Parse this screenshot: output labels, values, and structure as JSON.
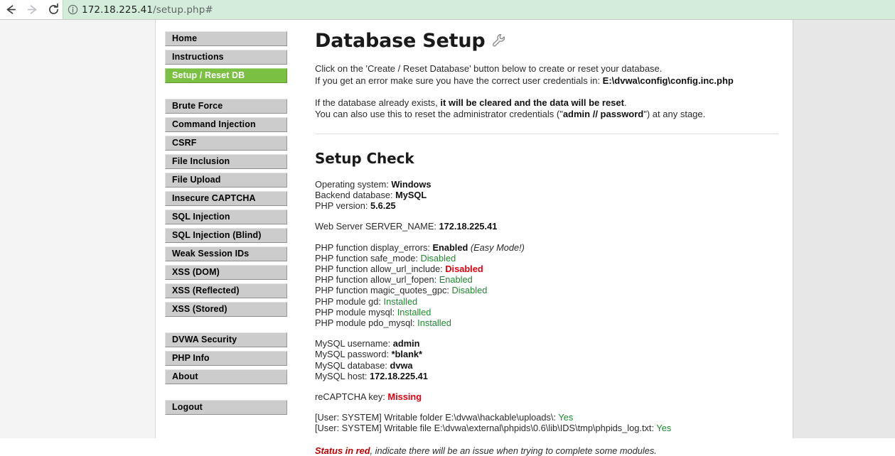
{
  "browser": {
    "back_icon": "arrow-left-icon",
    "forward_icon": "arrow-right-icon",
    "reload_icon": "reload-icon",
    "info_icon": "info-circle-icon",
    "url_host": "172.18.225.41",
    "url_path": "/setup.php#",
    "url_full": "172.18.225.41/setup.php#"
  },
  "sidebar": {
    "groups": [
      {
        "items": [
          {
            "label": "Home",
            "active": false
          },
          {
            "label": "Instructions",
            "active": false
          },
          {
            "label": "Setup / Reset DB",
            "active": true
          }
        ]
      },
      {
        "items": [
          {
            "label": "Brute Force",
            "active": false
          },
          {
            "label": "Command Injection",
            "active": false
          },
          {
            "label": "CSRF",
            "active": false
          },
          {
            "label": "File Inclusion",
            "active": false
          },
          {
            "label": "File Upload",
            "active": false
          },
          {
            "label": "Insecure CAPTCHA",
            "active": false
          },
          {
            "label": "SQL Injection",
            "active": false
          },
          {
            "label": "SQL Injection (Blind)",
            "active": false
          },
          {
            "label": "Weak Session IDs",
            "active": false
          },
          {
            "label": "XSS (DOM)",
            "active": false
          },
          {
            "label": "XSS (Reflected)",
            "active": false
          },
          {
            "label": "XSS (Stored)",
            "active": false
          }
        ]
      },
      {
        "items": [
          {
            "label": "DVWA Security",
            "active": false
          },
          {
            "label": "PHP Info",
            "active": false
          },
          {
            "label": "About",
            "active": false
          }
        ]
      },
      {
        "items": [
          {
            "label": "Logout",
            "active": false
          }
        ]
      }
    ]
  },
  "main": {
    "title": "Database Setup",
    "title_icon": "wrench-icon",
    "intro": {
      "line1": "Click on the 'Create / Reset Database' button below to create or reset your database.",
      "line2_prefix": "If you get an error make sure you have the correct user credentials in: ",
      "line2_path": "E:\\dvwa\\config\\config.inc.php"
    },
    "warning": {
      "line1_prefix": "If the database already exists, ",
      "line1_bold": "it will be cleared and the data will be reset",
      "line1_suffix": ".",
      "line2_prefix": "You can also use this to reset the administrator credentials (\"",
      "line2_bold": "admin // password",
      "line2_suffix": "\") at any stage."
    },
    "setup_check_title": "Setup Check",
    "system": [
      {
        "label": "Operating system: ",
        "value": "Windows",
        "status": "plain"
      },
      {
        "label": "Backend database: ",
        "value": "MySQL",
        "status": "plain"
      },
      {
        "label": "PHP version: ",
        "value": "5.6.25",
        "status": "plain"
      }
    ],
    "server": [
      {
        "label": "Web Server SERVER_NAME: ",
        "value": "172.18.225.41",
        "status": "plain"
      }
    ],
    "php_checks": [
      {
        "label": "PHP function display_errors: ",
        "value": "Enabled",
        "status": "plain",
        "note": " (Easy Mode!)"
      },
      {
        "label": "PHP function safe_mode: ",
        "value": "Disabled",
        "status": "ok"
      },
      {
        "label": "PHP function allow_url_include: ",
        "value": "Disabled",
        "status": "bad"
      },
      {
        "label": "PHP function allow_url_fopen: ",
        "value": "Enabled",
        "status": "ok"
      },
      {
        "label": "PHP function magic_quotes_gpc: ",
        "value": "Disabled",
        "status": "ok"
      },
      {
        "label": "PHP module gd: ",
        "value": "Installed",
        "status": "ok"
      },
      {
        "label": "PHP module mysql: ",
        "value": "Installed",
        "status": "ok"
      },
      {
        "label": "PHP module pdo_mysql: ",
        "value": "Installed",
        "status": "ok"
      }
    ],
    "mysql": [
      {
        "label": "MySQL username: ",
        "value": "admin",
        "status": "plain"
      },
      {
        "label": "MySQL password: ",
        "value": "*blank*",
        "status": "plain"
      },
      {
        "label": "MySQL database: ",
        "value": "dvwa",
        "status": "plain"
      },
      {
        "label": "MySQL host: ",
        "value": "172.18.225.41",
        "status": "plain"
      }
    ],
    "recaptcha": [
      {
        "label": "reCAPTCHA key: ",
        "value": "Missing",
        "status": "bad"
      }
    ],
    "writable": [
      {
        "label": "[User: SYSTEM] Writable folder E:\\dvwa\\hackable\\uploads\\: ",
        "value": "Yes",
        "status": "ok"
      },
      {
        "label": "[User: SYSTEM] Writable file E:\\dvwa\\external\\phpids\\0.6\\lib\\IDS\\tmp\\phpids_log.txt: ",
        "value": "Yes",
        "status": "ok"
      }
    ],
    "footnote": {
      "red_label": "Status in red",
      "rest": ", indicate there will be an issue when trying to complete some modules."
    }
  },
  "colors": {
    "active_nav": "#7ac043",
    "nav_button": "#cccccc",
    "url_bar": "#d4edda",
    "ok": "#1f8a2e",
    "bad": "#e8000d",
    "footnote_red": "#c00000"
  }
}
